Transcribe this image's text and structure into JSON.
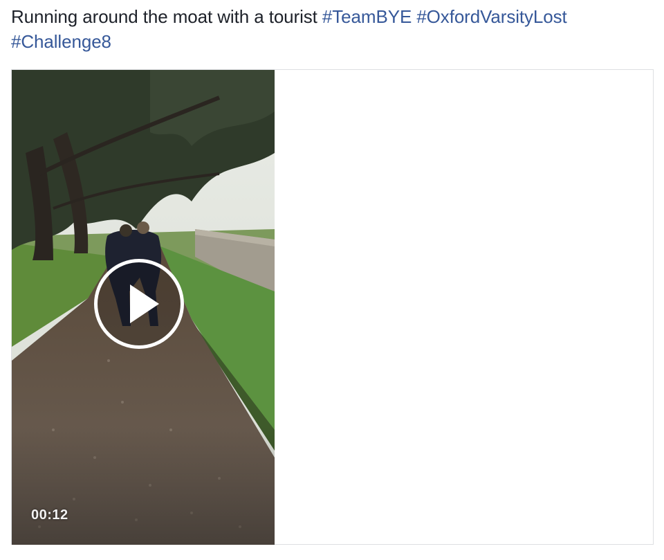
{
  "post": {
    "text": "Running around the moat with a tourist",
    "hashtags": [
      "#TeamBYE",
      "#OxfordVarsityLost",
      "#Challenge8"
    ]
  },
  "video": {
    "duration": "00:12",
    "play_icon": "play-icon"
  },
  "colors": {
    "text": "#1d2129",
    "hashtag": "#365899",
    "card_border": "#dddfe2"
  }
}
